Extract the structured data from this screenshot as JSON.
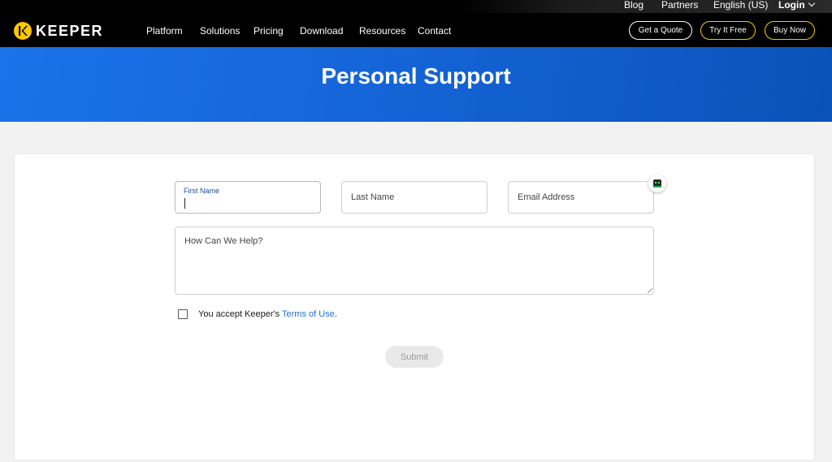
{
  "header": {
    "brand": "KEEPER",
    "utility_links": [
      "Blog",
      "Partners",
      "English (US)",
      "Login"
    ],
    "nav": [
      "Platform",
      "Solutions",
      "Pricing",
      "Download",
      "Resources",
      "Contact"
    ],
    "buttons": {
      "quote": "Get a Quote",
      "try": "Try It Free",
      "buy": "Buy Now"
    }
  },
  "hero": {
    "title": "Personal Support"
  },
  "form": {
    "first_name_label": "First Name",
    "first_name_value": "",
    "last_name_placeholder": "Last Name",
    "email_placeholder": "Email Address",
    "help_placeholder": "How Can We Help?",
    "terms_prefix": "You accept Keeper's ",
    "terms_link": "Terms of Use",
    "terms_suffix": ".",
    "submit_label": "Submit"
  },
  "colors": {
    "brand_yellow": "#ffc700",
    "hero_blue": "#1a73e8",
    "link_blue": "#1a6fd6"
  }
}
